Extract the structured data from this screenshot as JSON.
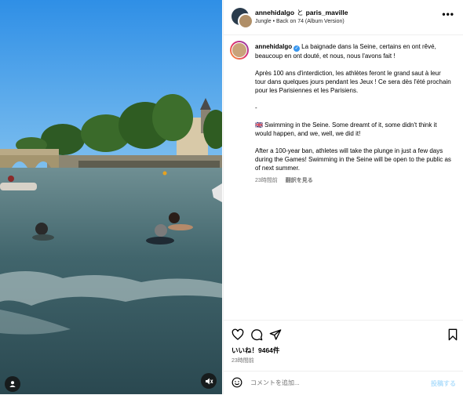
{
  "header": {
    "user1": "annehidalgo",
    "connector": "と",
    "user2": "paris_maville",
    "music": "Jungle • Back on 74 (Album Version)"
  },
  "caption": {
    "username": "annehidalgo",
    "p1": "La baignade dans la Seine, certains en ont rêvé, beaucoup en ont douté, et nous, nous l'avons fait !",
    "p2": "Après 100 ans d'interdiction, les athlètes feront le grand saut à leur tour dans quelques jours pendant les Jeux ! Ce sera dès l'été prochain pour les Parisiennes et les Parisiens.",
    "p3": "-",
    "p4": "🇬🇧 Swimming in the Seine. Some dreamt of it, some didn't think it would happen, and we, well, we did it!",
    "p5": "After a 100-year ban, athletes will take the plunge in just a few days during the Games! Swimming in the Seine will be open to the public as of next summer.",
    "time": "23時間前",
    "translate": "翻訳を見る"
  },
  "stats": {
    "likes": "いいね！9464件",
    "time": "23時間前"
  },
  "comment": {
    "placeholder": "コメントを追加...",
    "post": "投稿する"
  },
  "icons": {
    "like": "heart-icon",
    "comment": "comment-icon",
    "share": "send-icon",
    "save": "bookmark-icon",
    "emoji": "smiley-icon",
    "mute": "speaker-muted-icon",
    "tagged": "person-icon"
  },
  "colors": {
    "verified": "#3897f0",
    "post_button": "#b2dffc",
    "muted_text": "#737373"
  }
}
